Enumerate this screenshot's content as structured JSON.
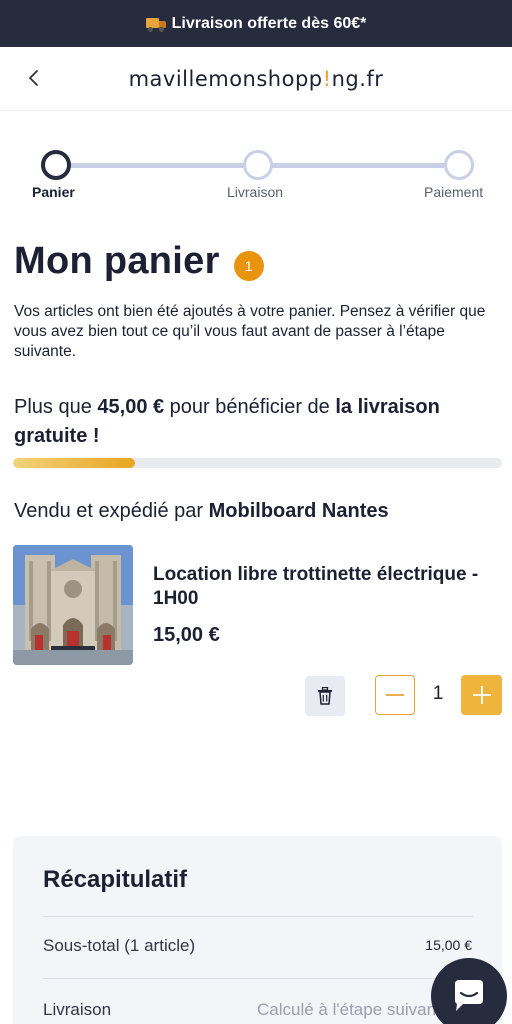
{
  "promo": {
    "text": "Livraison offerte dès 60€*",
    "icon": "truck-icon"
  },
  "header": {
    "back_icon": "chevron-left-icon",
    "logo_parts": [
      "mavillemonshopp",
      "!",
      "ng.fr"
    ]
  },
  "stepper": {
    "steps": [
      {
        "label": "Panier",
        "active": true
      },
      {
        "label": "Livraison",
        "active": false
      },
      {
        "label": "Paiement",
        "active": false
      }
    ]
  },
  "cart": {
    "title": "Mon panier",
    "count": "1",
    "intro": "Vos articles ont bien été ajoutés à votre panier. Pensez à vérifier que vous avez bien tout ce qu’il vous faut avant de passer à l’étape suivante.",
    "shipping_prefix": "Plus que ",
    "shipping_amount": "45,00 €",
    "shipping_middle": " pour bénéficier de ",
    "shipping_highlight": "la livraison gratuite !",
    "free_shipping_progress": 0.25,
    "seller_prefix": "Vendu et expédié par ",
    "seller_name": "Mobilboard Nantes"
  },
  "item": {
    "name": "Location libre trottinette électrique - 1H00",
    "price": "15,00 €",
    "quantity": "1",
    "image": "cathedral-photo"
  },
  "summary": {
    "title": "Récapitulatif",
    "subtotal_label": "Sous-total (1 article)",
    "subtotal_value": "15,00 €",
    "delivery_label": "Livraison",
    "delivery_value": "Calculé à l'étape suivante"
  },
  "colors": {
    "dark": "#262b3d",
    "accent": "#e8a33b",
    "badge": "#e8940f",
    "stepper_inactive": "#c9d0e6"
  }
}
